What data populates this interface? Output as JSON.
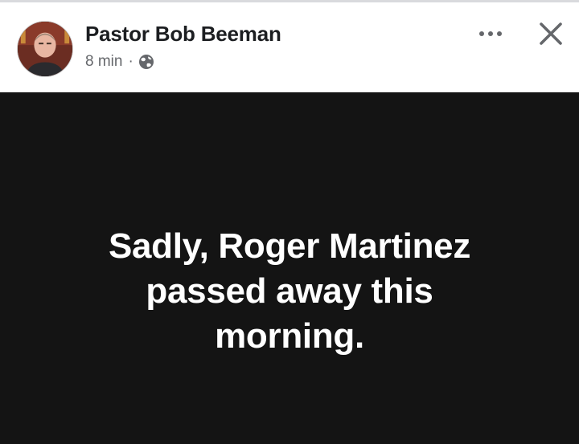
{
  "post": {
    "author_name": "Pastor Bob Beeman",
    "timestamp": "8 min",
    "separator": "·",
    "audience_icon": "globe-icon",
    "more_icon": "more-options-icon",
    "close_icon": "close-icon",
    "text_lines": [
      "Sadly, Roger Martinez",
      "passed away this",
      "morning."
    ],
    "background_color": "#141414",
    "text_color": "#ffffff"
  }
}
